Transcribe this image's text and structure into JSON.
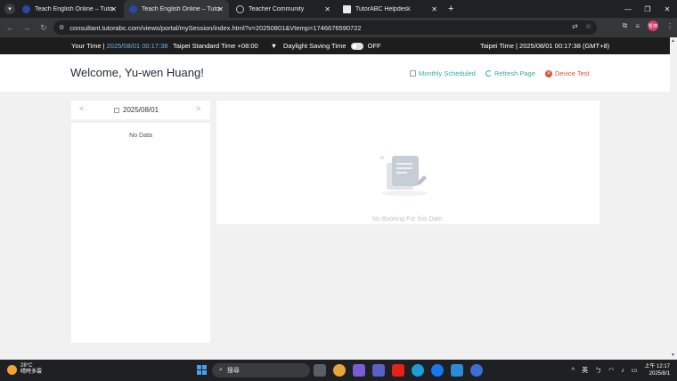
{
  "browser": {
    "tabs": [
      {
        "title": "Teach English Online – TutorABC",
        "active": false
      },
      {
        "title": "Teach English Online – TutorABC",
        "active": true
      },
      {
        "title": "Teacher Community",
        "active": false
      },
      {
        "title": "TutorABC Helpdesk",
        "active": false
      }
    ],
    "url": "consultant.tutorabc.com/views/portal/mySession/index.html?v=20250801&Vtemp=1746676590722",
    "profile_label": "暫停"
  },
  "timebar": {
    "your_time_label": "Your Time |",
    "your_time_value": "2025/08/01 00:17:38",
    "timezone": "Taipei Standard Time +08:00",
    "dst_label": "Daylight Saving Time",
    "dst_state": "OFF",
    "taipei_time": "Taipei Time | 2025/08/01 00:17:38 (GMT+8)"
  },
  "header": {
    "welcome": "Welcome, Yu-wen Huang!",
    "monthly": "Monthly Scheduled",
    "refresh": "Refresh Page",
    "device": "Device Test"
  },
  "datepicker": {
    "date": "2025/08/01",
    "prev": "<",
    "next": ">"
  },
  "left_panel": {
    "empty": "No Data"
  },
  "right_panel": {
    "empty": "No Booking For this Date."
  },
  "taskbar": {
    "temp": "28°C",
    "weather": "晴時多雲",
    "search_placeholder": "搜尋",
    "ime": "英",
    "time": "上午 12:17",
    "date": "2025/8/1"
  },
  "colors": {
    "accent_teal": "#2eaea5",
    "accent_red": "#e74c3c",
    "timebar_bg": "#1d1d1d"
  }
}
